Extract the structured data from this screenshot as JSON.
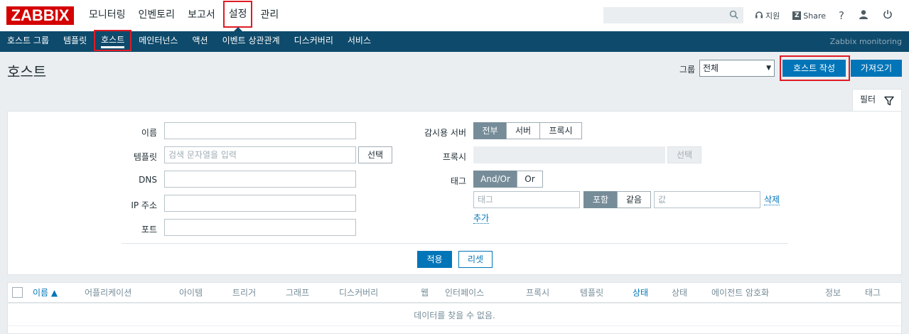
{
  "topnav": {
    "logo": "ZABBIX",
    "menu": [
      {
        "label": "모니터링"
      },
      {
        "label": "인벤토리"
      },
      {
        "label": "보고서"
      },
      {
        "label": "설정"
      },
      {
        "label": "관리"
      }
    ],
    "selected_index": 3,
    "search_placeholder": "",
    "support_label": "지원",
    "share_label": "Share",
    "help_label": "?"
  },
  "subnav": {
    "items": [
      {
        "label": "호스트 그룹"
      },
      {
        "label": "템플릿"
      },
      {
        "label": "호스트"
      },
      {
        "label": "메인터넌스"
      },
      {
        "label": "액션"
      },
      {
        "label": "이벤트 상관관계"
      },
      {
        "label": "디스커버리"
      },
      {
        "label": "서비스"
      }
    ],
    "selected_index": 2,
    "brand": "Zabbix monitoring"
  },
  "header": {
    "title": "호스트",
    "group_label": "그룹",
    "group_value": "전체",
    "create_button": "호스트 작성",
    "import_button": "가져오기"
  },
  "filter": {
    "tab_label": "필터",
    "name_label": "이름",
    "name_value": "",
    "templates_label": "템플릿",
    "templates_placeholder": "검색 문자열을 입력",
    "templates_select": "선택",
    "dns_label": "DNS",
    "ip_label": "IP 주소",
    "port_label": "포트",
    "monitored_by_label": "감시용 서버",
    "monitored_by_options": [
      {
        "label": "전부"
      },
      {
        "label": "서버"
      },
      {
        "label": "프록시"
      }
    ],
    "monitored_by_selected": 0,
    "proxy_label": "프록시",
    "proxy_select": "선택",
    "tags_label": "태그",
    "tags_mode_options": [
      {
        "label": "And/Or"
      },
      {
        "label": "Or"
      }
    ],
    "tags_mode_selected": 0,
    "tag_placeholder": "태그",
    "tag_operator_options": [
      {
        "label": "포함"
      },
      {
        "label": "같음"
      }
    ],
    "tag_operator_selected": 0,
    "value_placeholder": "값",
    "remove_link": "삭제",
    "add_link": "추가",
    "apply_button": "적용",
    "reset_button": "리셋"
  },
  "table": {
    "columns": [
      {
        "label": "이름 ▲",
        "sortable": true
      },
      {
        "label": "어플리케이션",
        "sortable": false
      },
      {
        "label": "아이템",
        "sortable": false
      },
      {
        "label": "트리거",
        "sortable": false
      },
      {
        "label": "그래프",
        "sortable": false
      },
      {
        "label": "디스커버리",
        "sortable": false
      },
      {
        "label": "웹",
        "sortable": false
      },
      {
        "label": "인터페이스",
        "sortable": false
      },
      {
        "label": "프록시",
        "sortable": false
      },
      {
        "label": "템플릿",
        "sortable": false
      },
      {
        "label": "상태",
        "sortable": true
      },
      {
        "label": "상태",
        "sortable": false
      },
      {
        "label": "에이전트 암호화",
        "sortable": false
      },
      {
        "label": "정보",
        "sortable": false
      },
      {
        "label": "태그",
        "sortable": false
      }
    ],
    "empty_message": "데이터를 찾을 수 없음."
  },
  "colors": {
    "brand_red": "#d40000",
    "nav_blue": "#0e4a6b",
    "primary": "#0275b8",
    "highlight": "#e01b24"
  }
}
